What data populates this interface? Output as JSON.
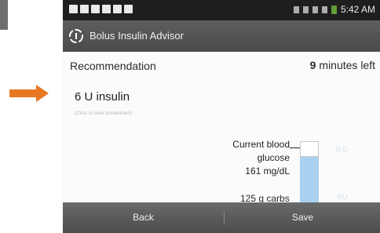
{
  "status_bar": {
    "time": "5:42 AM",
    "icons": [
      "notification-icon",
      "notification-icon",
      "home-icon",
      "calendar-icon",
      "mail-icon",
      "messaging-icon",
      "bluetooth-icon",
      "nfc-icon",
      "wifi-icon",
      "signal-icon",
      "battery-icon"
    ],
    "battery_color": "#7ac943"
  },
  "app_bar": {
    "title": "Bolus Insulin Advisor"
  },
  "recommendation": {
    "label": "Recommendation",
    "minutes_value": "9",
    "minutes_suffix": "minutes left",
    "dose": "6 U insulin",
    "subtext": "(Click to view breakdown)"
  },
  "gauge": {
    "glucose_label": "Current blood glucose",
    "glucose_value": "161 mg/dL",
    "scale_top": "0.0",
    "scale_bottom": "6U",
    "carbs": "125 g carbs",
    "fill_fraction": 0.8,
    "fill_color": "#a9d1ef"
  },
  "bottom_bar": {
    "back_label": "Back",
    "save_label": "Save"
  },
  "accent": {
    "arrow_color": "#e87722"
  }
}
